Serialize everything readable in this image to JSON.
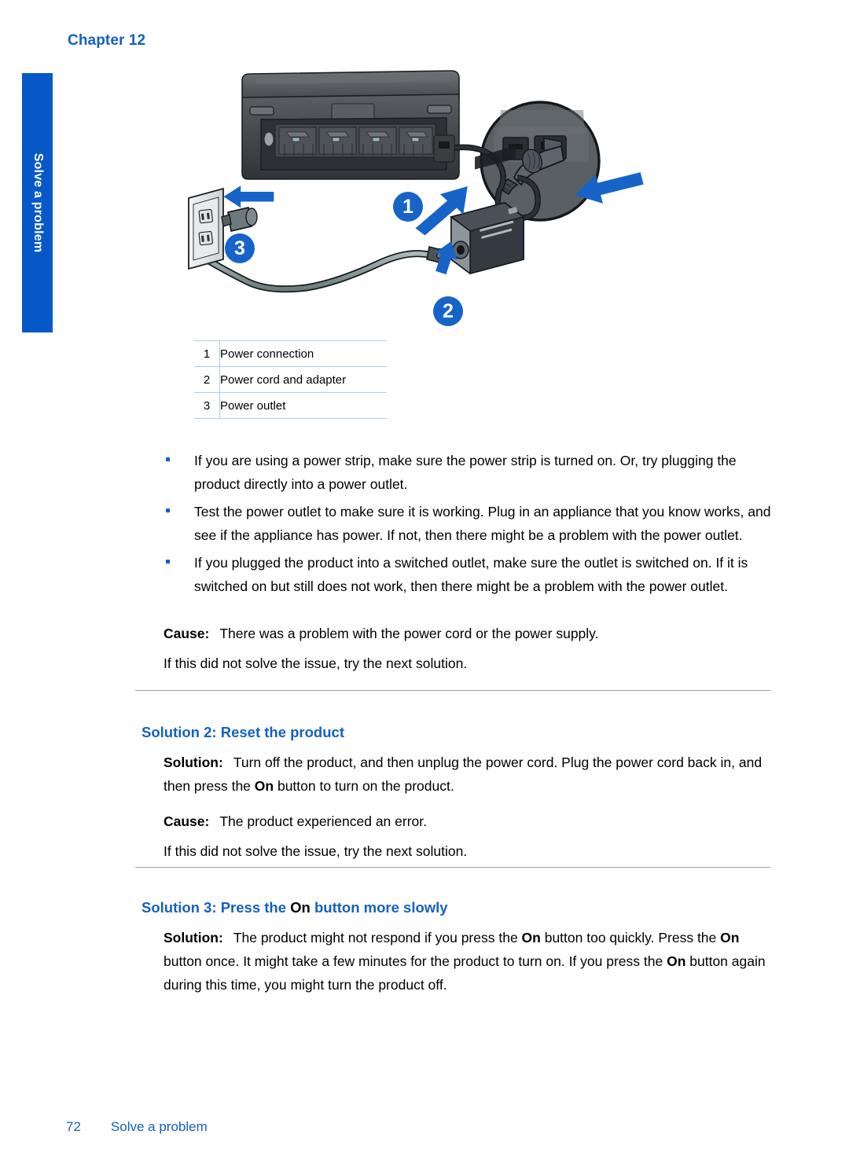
{
  "header": {
    "chapter": "Chapter 12"
  },
  "side_tab": {
    "label": "Solve a problem"
  },
  "figure": {
    "callouts": [
      "1",
      "2",
      "3"
    ],
    "legend_rows": [
      {
        "num": "1",
        "text": "Power connection"
      },
      {
        "num": "2",
        "text": "Power cord and adapter"
      },
      {
        "num": "3",
        "text": "Power outlet"
      }
    ]
  },
  "bullets": [
    "If you are using a power strip, make sure the power strip is turned on. Or, try plugging the product directly into a power outlet.",
    "Test the power outlet to make sure it is working. Plug in an appliance that you know works, and see if the appliance has power. If not, then there might be a problem with the power outlet.",
    "If you plugged the product into a switched outlet, make sure the outlet is switched on. If it is switched on but still does not work, then there might be a problem with the power outlet."
  ],
  "cause1": {
    "label": "Cause:",
    "text": "There was a problem with the power cord or the power supply."
  },
  "next_solution_1": "If this did not solve the issue, try the next solution.",
  "solution2": {
    "heading": "Solution 2: Reset the product",
    "label": "Solution:",
    "text_part1": "Turn off the product, and then unplug the power cord. Plug the power cord back in, and then press the ",
    "bold_on": "On",
    "text_part2": " button to turn on the product.",
    "cause_label": "Cause:",
    "cause_text": "The product experienced an error.",
    "next": "If this did not solve the issue, try the next solution."
  },
  "solution3": {
    "heading_part1": "Solution 3: Press the ",
    "heading_on": "On",
    "heading_part2": " button more slowly",
    "label": "Solution:",
    "text_part1": "The product might not respond if you press the ",
    "on_1": "On",
    "text_part2": " button too quickly. Press the ",
    "on_2": "On",
    "text_part3": " button once. It might take a few minutes for the product to turn on. If you press the ",
    "on_3": "On",
    "text_part4": " button again during this time, you might turn the product off."
  },
  "footer": {
    "page_number": "72",
    "section": "Solve a problem"
  },
  "colors": {
    "accent_blue": "#1560c0",
    "tab_blue": "#0658c6",
    "rule_gray": "#9d9d9d",
    "table_rule": "#aecbe8"
  }
}
